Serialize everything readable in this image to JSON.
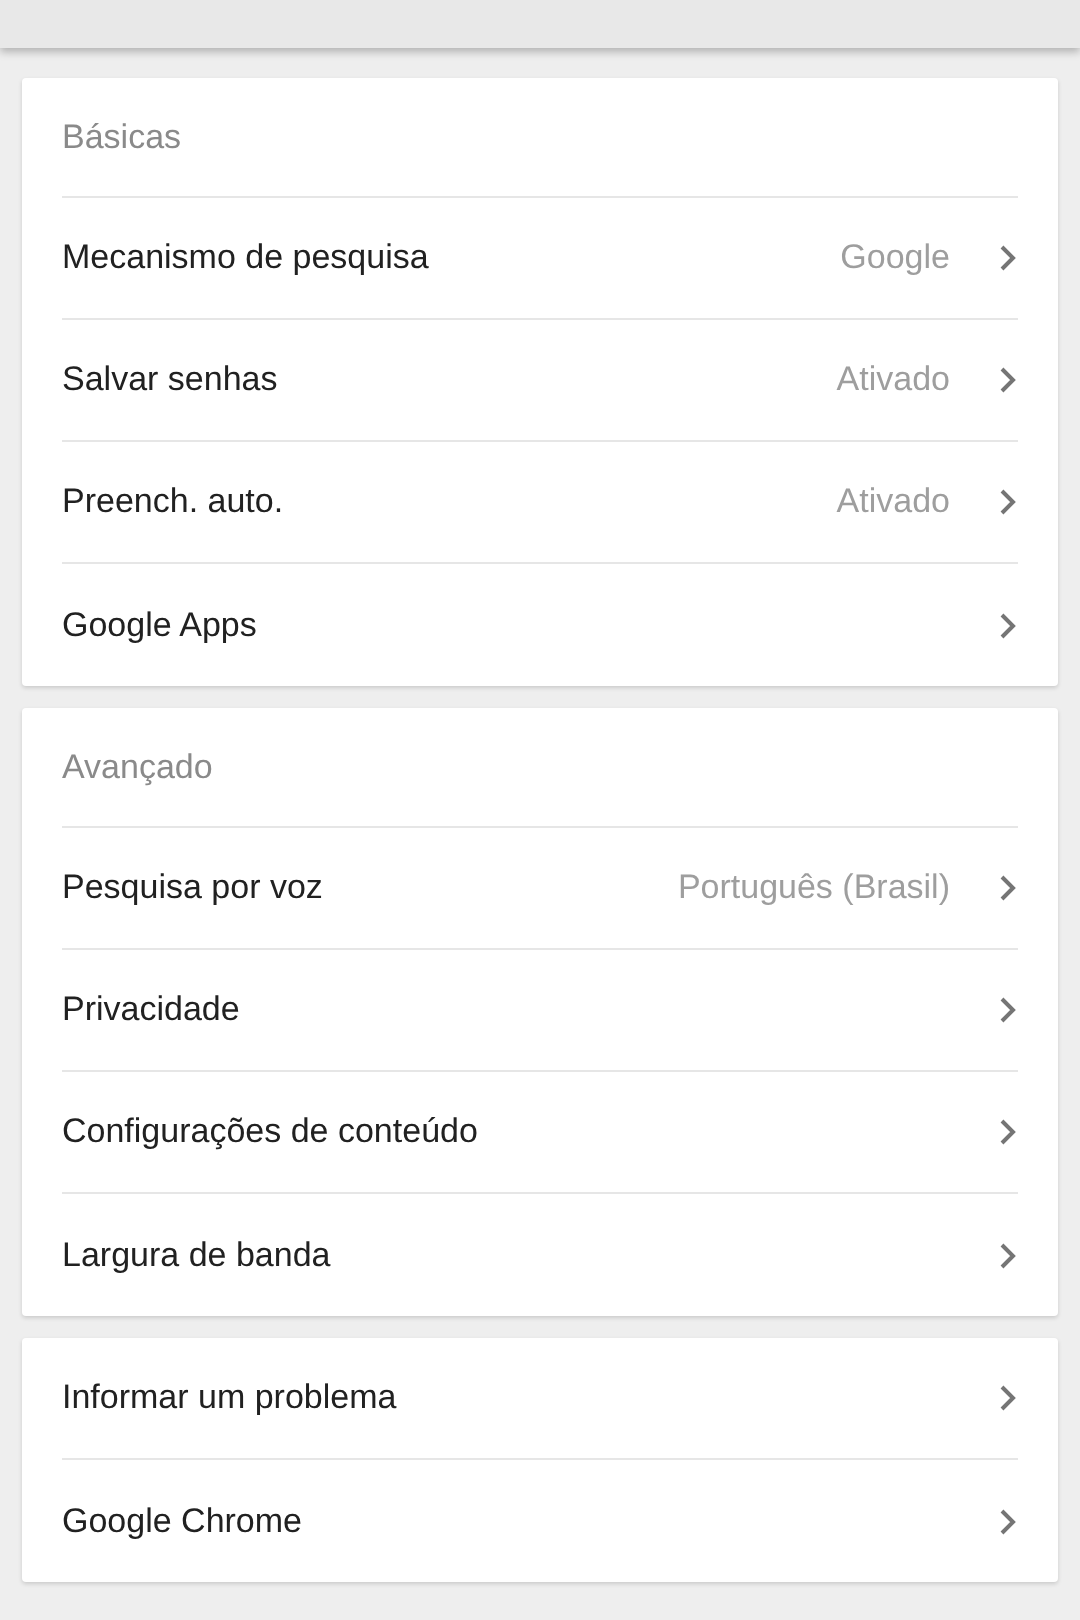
{
  "sections": [
    {
      "title": "Básicas",
      "items": [
        {
          "label": "Mecanismo de pesquisa",
          "value": "Google"
        },
        {
          "label": "Salvar senhas",
          "value": "Ativado"
        },
        {
          "label": "Preench. auto.",
          "value": "Ativado"
        },
        {
          "label": "Google Apps"
        }
      ]
    },
    {
      "title": "Avançado",
      "items": [
        {
          "label": "Pesquisa por voz",
          "value": "Português (Brasil)"
        },
        {
          "label": "Privacidade"
        },
        {
          "label": "Configurações de conteúdo"
        },
        {
          "label": "Largura de banda"
        }
      ]
    },
    {
      "items": [
        {
          "label": "Informar um problema"
        },
        {
          "label": "Google Chrome"
        }
      ]
    }
  ]
}
